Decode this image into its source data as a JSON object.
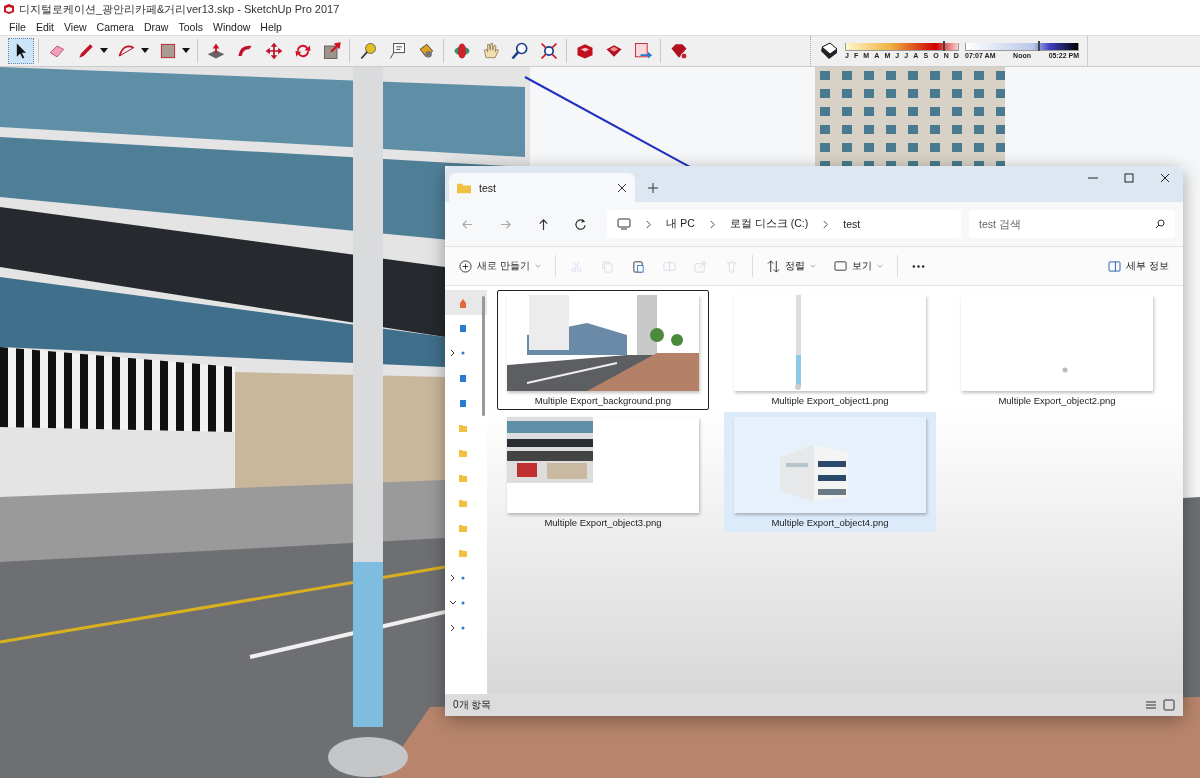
{
  "window": {
    "title": "디지털로케이션_광안리카페&거리ver13.skp - SketchUp Pro 2017"
  },
  "menu": [
    "File",
    "Edit",
    "View",
    "Camera",
    "Draw",
    "Tools",
    "Window",
    "Help"
  ],
  "tools": [
    {
      "kind": "select",
      "selected": true
    },
    {
      "kind": "sep"
    },
    {
      "kind": "eraser",
      "selected": false
    },
    {
      "kind": "pencil",
      "selected": false,
      "dropdown": true
    },
    {
      "kind": "arc",
      "selected": false,
      "dropdown": true
    },
    {
      "kind": "rect",
      "selected": false,
      "dropdown": true
    },
    {
      "kind": "sep"
    },
    {
      "kind": "pushpull",
      "selected": false
    },
    {
      "kind": "followme",
      "selected": false
    },
    {
      "kind": "move",
      "selected": false
    },
    {
      "kind": "rotate",
      "selected": false
    },
    {
      "kind": "scale",
      "selected": false
    },
    {
      "kind": "sep"
    },
    {
      "kind": "tape",
      "selected": false
    },
    {
      "kind": "text",
      "selected": false
    },
    {
      "kind": "paint",
      "selected": false
    },
    {
      "kind": "sep"
    },
    {
      "kind": "orbit",
      "selected": false
    },
    {
      "kind": "pan",
      "selected": false
    },
    {
      "kind": "zoom",
      "selected": false
    },
    {
      "kind": "extents",
      "selected": false
    },
    {
      "kind": "sep"
    },
    {
      "kind": "warehouse",
      "selected": false
    },
    {
      "kind": "extension",
      "selected": false
    },
    {
      "kind": "layout",
      "selected": false
    },
    {
      "kind": "sep"
    },
    {
      "kind": "ruby",
      "selected": false
    }
  ],
  "shadow_settings": {
    "months": [
      "J",
      "F",
      "M",
      "A",
      "M",
      "J",
      "J",
      "A",
      "S",
      "O",
      "N",
      "D"
    ],
    "month_slider": {
      "level": 0.87
    },
    "times": [
      "07:07 AM",
      "Noon",
      "05:22 PM"
    ],
    "time_slider": {
      "level": 0.64
    }
  },
  "explorer": {
    "tabs": [
      {
        "label": "test",
        "selected": true
      }
    ],
    "breadcrumb": [
      "내 PC",
      "로컬 디스크 (C:)",
      "test"
    ],
    "search": {
      "placeholder": "test 검색"
    },
    "commands": [
      {
        "kind": "new",
        "label": "새로 만들기",
        "disabled": false
      },
      {
        "kind": "cut",
        "disabled": true
      },
      {
        "kind": "copy",
        "disabled": true
      },
      {
        "kind": "paste",
        "disabled": false
      },
      {
        "kind": "rename",
        "disabled": true
      },
      {
        "kind": "share",
        "disabled": true
      },
      {
        "kind": "delete",
        "disabled": true
      },
      {
        "kind": "sort",
        "label": "정렬",
        "disabled": false
      },
      {
        "kind": "view",
        "label": "보기",
        "disabled": false
      },
      {
        "kind": "more",
        "disabled": false
      }
    ],
    "details": {
      "label": "세부 정보"
    },
    "nav": [
      {
        "kind": "home"
      },
      {
        "kind": "drive"
      },
      {
        "kind": "branch",
        "expanded": false
      },
      {
        "kind": "drive"
      },
      {
        "kind": "drive"
      },
      {
        "kind": "folder"
      },
      {
        "kind": "folder"
      },
      {
        "kind": "folder"
      },
      {
        "kind": "folder"
      },
      {
        "kind": "folder"
      },
      {
        "kind": "folder"
      },
      {
        "kind": "branch",
        "expanded": false
      },
      {
        "kind": "branch",
        "expanded": true
      },
      {
        "kind": "branch",
        "expanded": false
      }
    ],
    "files": [
      {
        "name": "Multiple Export_background.png",
        "selected": false,
        "focused": true
      },
      {
        "name": "Multiple Export_object1.png",
        "selected": false,
        "focused": false
      },
      {
        "name": "Multiple Export_object2.png",
        "selected": false,
        "focused": false
      },
      {
        "name": "Multiple Export_object3.png",
        "selected": false,
        "focused": false
      },
      {
        "name": "Multiple Export_object4.png",
        "selected": true,
        "focused": false
      }
    ],
    "status": "0개 항목"
  }
}
